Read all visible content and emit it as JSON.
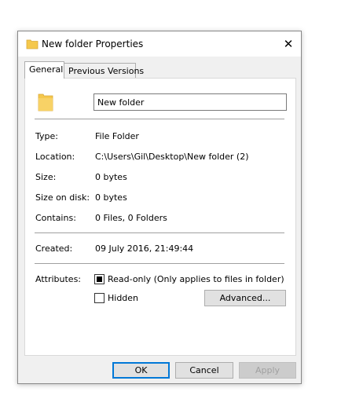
{
  "window": {
    "title": "New folder Properties",
    "close_glyph": "✕",
    "accent_color": "#0078d7",
    "folder_color": "#f5c84c"
  },
  "tabs": [
    {
      "label": "General",
      "selected": true
    },
    {
      "label": "Previous Versions",
      "selected": false
    }
  ],
  "general": {
    "name_value": "New folder",
    "rows": [
      {
        "label": "Type:",
        "value": "File Folder"
      },
      {
        "label": "Location:",
        "value": "C:\\Users\\Gil\\Desktop\\New folder (2)"
      },
      {
        "label": "Size:",
        "value": "0 bytes"
      },
      {
        "label": "Size on disk:",
        "value": "0 bytes"
      },
      {
        "label": "Contains:",
        "value": "0 Files, 0 Folders"
      }
    ],
    "created": {
      "label": "Created:",
      "value": "09 July 2016, 21:49:44"
    },
    "attributes": {
      "label": "Attributes:",
      "readonly": {
        "label": "Read-only (Only applies to files in folder)",
        "checked": "indeterminate"
      },
      "hidden": {
        "label": "Hidden",
        "checked": false
      },
      "advanced_label": "Advanced..."
    }
  },
  "buttons": {
    "ok": "OK",
    "cancel": "Cancel",
    "apply": "Apply"
  }
}
